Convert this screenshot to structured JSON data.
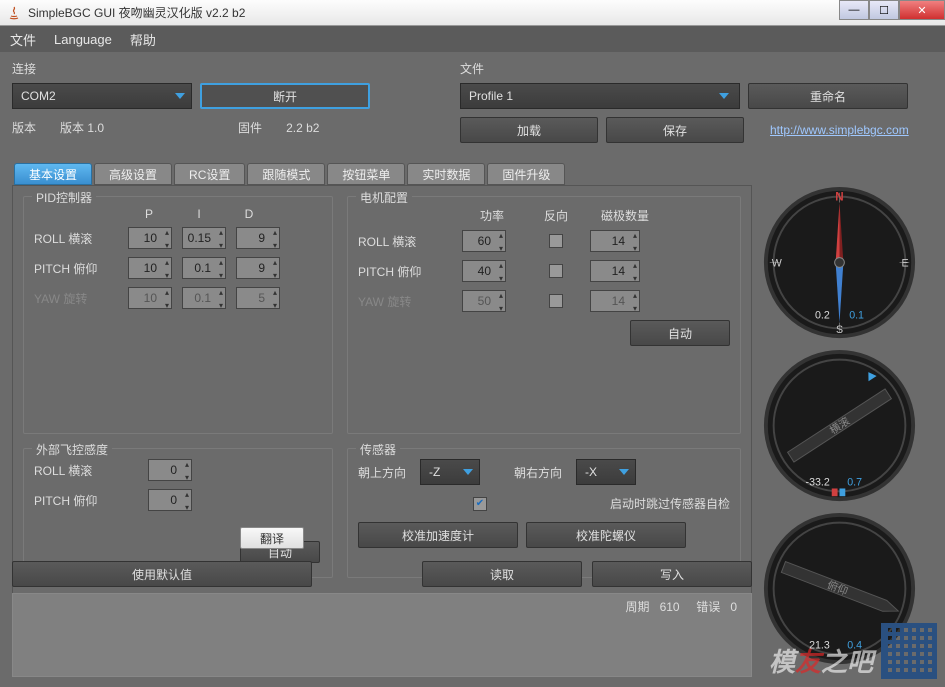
{
  "window": {
    "title": "SimpleBGC GUI 夜吻幽灵汉化版 v2.2 b2"
  },
  "menu": {
    "file": "文件",
    "language": "Language",
    "help": "帮助"
  },
  "connection": {
    "label": "连接",
    "port": "COM2",
    "disconnect": "断开",
    "version_label": "版本",
    "version_value": "版本 1.0",
    "firmware_label": "固件",
    "firmware_value": "2.2 b2"
  },
  "file": {
    "label": "文件",
    "profile": "Profile 1",
    "rename": "重命名",
    "load": "加载",
    "save": "保存",
    "link": "http://www.simplebgc.com"
  },
  "tabs": {
    "basic": "基本设置",
    "advanced": "高级设置",
    "rc": "RC设置",
    "follow": "跟随模式",
    "menu_btn": "按钮菜单",
    "realtime": "实时数据",
    "firmware": "固件升级"
  },
  "pid": {
    "title": "PID控制器",
    "P": "P",
    "I": "I",
    "D": "D",
    "roll_label": "ROLL 横滚",
    "roll_p": "10",
    "roll_i": "0.15",
    "roll_d": "9",
    "pitch_label": "PITCH 俯仰",
    "pitch_p": "10",
    "pitch_i": "0.1",
    "pitch_d": "9",
    "yaw_label": "YAW 旋转",
    "yaw_p": "10",
    "yaw_i": "0.1",
    "yaw_d": "5"
  },
  "motor": {
    "title": "电机配置",
    "power": "功率",
    "invert": "反向",
    "poles": "磁极数量",
    "roll_label": "ROLL 横滚",
    "roll_power": "60",
    "roll_poles": "14",
    "pitch_label": "PITCH 俯仰",
    "pitch_power": "40",
    "pitch_poles": "14",
    "yaw_label": "YAW 旋转",
    "yaw_power": "50",
    "yaw_poles": "14",
    "auto": "自动"
  },
  "ext": {
    "title": "外部飞控感度",
    "roll_label": "ROLL 横滚",
    "roll_val": "0",
    "pitch_label": "PITCH 俯仰",
    "pitch_val": "0",
    "translate": "翻译",
    "auto_partial": "目动"
  },
  "sensor": {
    "title": "传感器",
    "top_label": "朝上方向",
    "top_val": "-Z",
    "right_label": "朝右方向",
    "right_val": "-X",
    "skip_check": "启动时跳过传感器自检",
    "calib_acc": "校准加速度计",
    "calib_gyro": "校准陀螺仪"
  },
  "bottom": {
    "defaults": "使用默认值",
    "read": "读取",
    "write": "写入"
  },
  "status": {
    "cycle_label": "周期",
    "cycle_val": "610",
    "error_label": "错误",
    "error_val": "0"
  },
  "gauges": {
    "compass_a": "0.2",
    "compass_b": "0.1",
    "roll_label": "横滚",
    "roll_a": "-33.2",
    "roll_b": "0.7",
    "pitch_label": "俯仰",
    "pitch_a": "21.3",
    "pitch_b": "0.4",
    "N": "N",
    "S": "S",
    "E": "E",
    "W": "W"
  }
}
